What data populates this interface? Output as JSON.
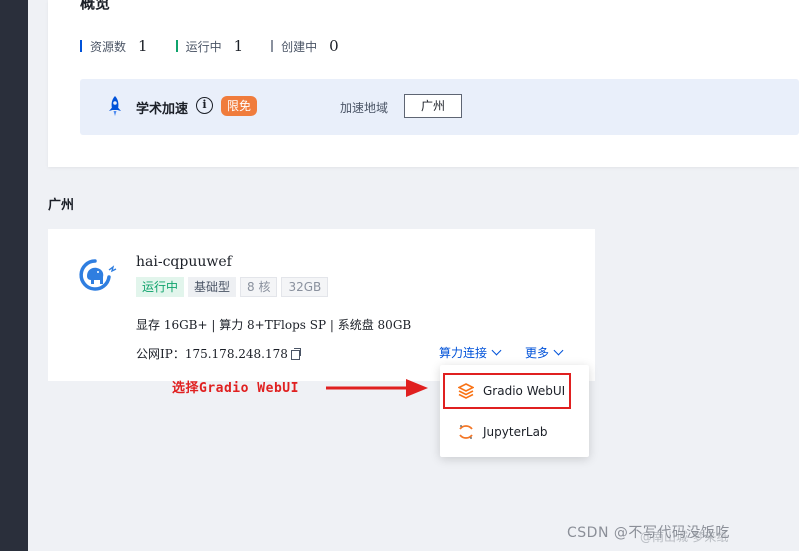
{
  "overview": {
    "title": "概览",
    "stats": [
      {
        "label": "资源数",
        "value": "1",
        "color": "#0052d9"
      },
      {
        "label": "运行中",
        "value": "1",
        "color": "#0fa36c"
      },
      {
        "label": "创建中",
        "value": "0",
        "color": "#8a919e"
      }
    ]
  },
  "academic_accel": {
    "title": "学术加速",
    "info_glyph": "i",
    "badge": "限免",
    "region_label": "加速地域",
    "region_value": "广州"
  },
  "section": {
    "title": "广州"
  },
  "instance": {
    "name": "hai-cqpuuwef",
    "status": "运行中",
    "type": "基础型",
    "cores": "8 核",
    "memory": "32GB",
    "specs": "显存 16GB+ | 算力 8+TFlops SP | 系统盘 80GB",
    "ip_label": "公网IP：",
    "ip_value": "175.178.248.178",
    "connect_label": "算力连接",
    "more_label": "更多"
  },
  "dropdown": {
    "items": [
      {
        "label": "Gradio WebUI",
        "icon": "gradio-icon"
      },
      {
        "label": "JupyterLab",
        "icon": "jupyter-icon"
      }
    ]
  },
  "annotation": {
    "text": "选择Gradio WebUI",
    "color": "#e02020"
  },
  "watermark": {
    "text": "CSDN @不写代码没饭吃",
    "shadow_text": "@南山城-梦来纸"
  }
}
